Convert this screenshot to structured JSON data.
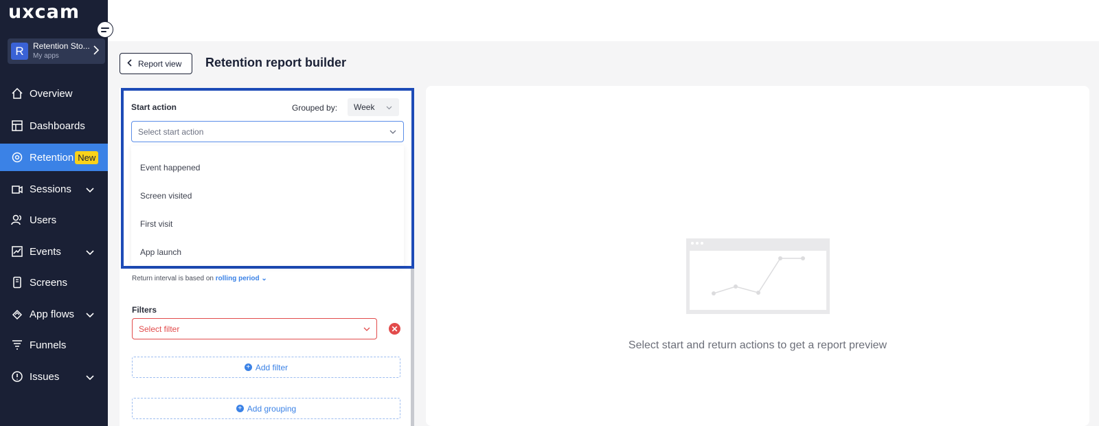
{
  "brand": {
    "logo_text": "uxcam"
  },
  "app_switcher": {
    "avatar_letter": "R",
    "name": "Retention Sto...",
    "subtitle": "My apps"
  },
  "sidebar": {
    "items": [
      {
        "label": "Overview",
        "icon": "home-icon"
      },
      {
        "label": "Dashboards",
        "icon": "dashboard-icon"
      },
      {
        "label": "Retention",
        "icon": "retention-icon",
        "badge": "New",
        "active": true
      },
      {
        "label": "Sessions",
        "icon": "sessions-icon",
        "expandable": true
      },
      {
        "label": "Users",
        "icon": "users-icon"
      },
      {
        "label": "Events",
        "icon": "events-icon",
        "expandable": true
      },
      {
        "label": "Screens",
        "icon": "screens-icon"
      },
      {
        "label": "App flows",
        "icon": "app-flows-icon",
        "expandable": true
      },
      {
        "label": "Funnels",
        "icon": "funnel-icon"
      },
      {
        "label": "Issues",
        "icon": "issues-icon",
        "expandable": true
      }
    ]
  },
  "header": {
    "back_label": "Report view",
    "title": "Retention report builder"
  },
  "builder": {
    "start_action_label": "Start action",
    "grouped_by_label": "Grouped by:",
    "grouped_by_value": "Week",
    "start_action_placeholder": "Select start action",
    "dropdown_options": [
      "Event happened",
      "Screen visited",
      "First visit",
      "App launch"
    ],
    "interval_text": "Return interval is based on",
    "interval_link": "rolling period",
    "filters_label": "Filters",
    "filter_placeholder": "Select filter",
    "add_filter_label": "Add filter",
    "add_grouping_label": "Add grouping"
  },
  "preview": {
    "message": "Select start and return actions to get a report preview"
  },
  "colors": {
    "sidebar_bg": "#1a2035",
    "accent": "#3b82e6",
    "badge": "#f9d21a",
    "error": "#e24b4b",
    "highlight_border": "#1d4bb7"
  }
}
